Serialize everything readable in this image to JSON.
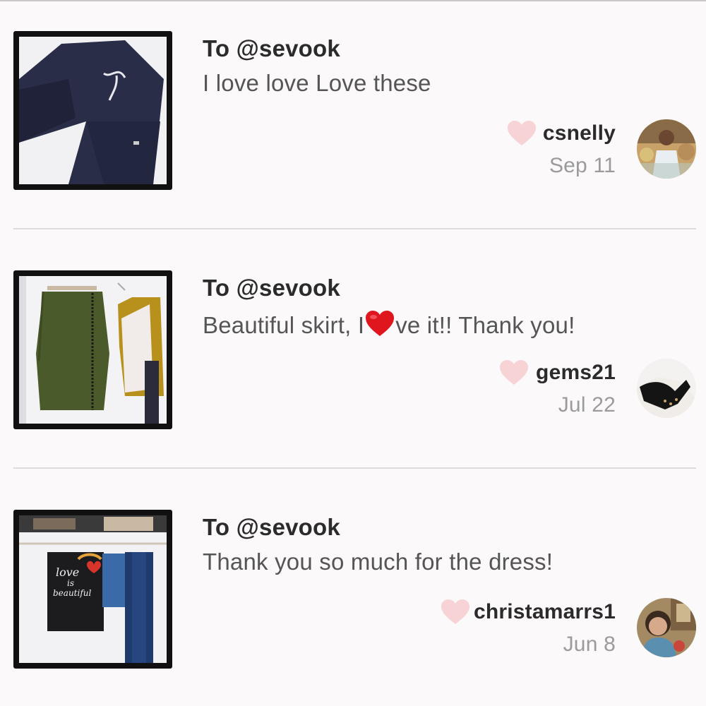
{
  "colors": {
    "background": "#fbf9fa",
    "heart_pink": "#f7d3d6",
    "emoji_red": "#e0161f",
    "divider": "#dddbdc"
  },
  "reviews": [
    {
      "to_label": "To @sevook",
      "message": "I love love Love these",
      "username": "csnelly",
      "date": "Sep 11",
      "like_icon": "heart-icon",
      "thumb": "navy sweatpants photo"
    },
    {
      "to_label": "To @sevook",
      "message_before": "Beautiful skirt, I",
      "message_emoji": "red-heart-emoji",
      "message_after": "ve it!! Thank you!",
      "username": "gems21",
      "date": "Jul 22",
      "like_icon": "heart-icon",
      "thumb": "olive pencil skirt photo"
    },
    {
      "to_label": "To @sevook",
      "message": "Thank you so much for the dress!",
      "username": "christamarrs1",
      "date": "Jun 8",
      "like_icon": "heart-icon",
      "thumb": "clothing rack photo",
      "thumb_text": [
        "love",
        "is",
        "beautiful"
      ]
    }
  ]
}
